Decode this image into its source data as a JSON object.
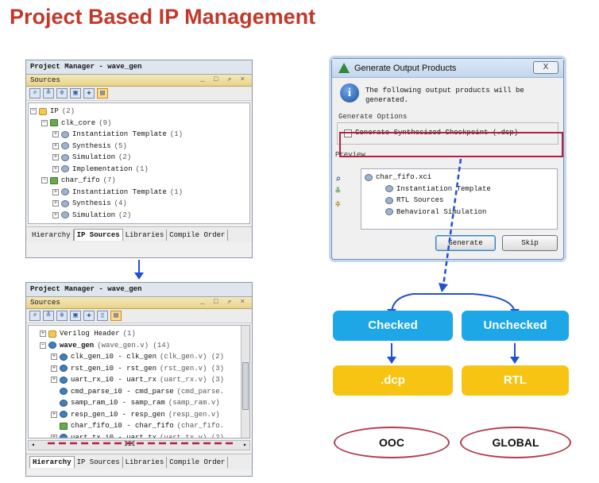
{
  "title": "Project Based IP Management",
  "top_panel": {
    "pm_title": "Project Manager - wave_gen",
    "sources_label": "Sources",
    "window_controls": "_ □ ⇗ ×",
    "tree": [
      {
        "exp": "−",
        "icon": "fold",
        "text": "IP",
        "extra": "(2)",
        "indent": 0,
        "bold": false
      },
      {
        "exp": "−",
        "icon": "ipico",
        "text": "clk_core",
        "extra": "(9)",
        "indent": 1,
        "bold": false
      },
      {
        "exp": "+",
        "icon": "gear",
        "text": "Instantiation Template",
        "extra": "(1)",
        "indent": 2,
        "bold": false
      },
      {
        "exp": "+",
        "icon": "gear",
        "text": "Synthesis",
        "extra": "(5)",
        "indent": 2,
        "bold": false
      },
      {
        "exp": "+",
        "icon": "gear",
        "text": "Simulation",
        "extra": "(2)",
        "indent": 2,
        "bold": false
      },
      {
        "exp": "+",
        "icon": "gear",
        "text": "Implementation",
        "extra": "(1)",
        "indent": 2,
        "bold": false
      },
      {
        "exp": "−",
        "icon": "ipico",
        "text": "char_fifo",
        "extra": "(7)",
        "indent": 1,
        "bold": false
      },
      {
        "exp": "+",
        "icon": "gear",
        "text": "Instantiation Template",
        "extra": "(1)",
        "indent": 2,
        "bold": false
      },
      {
        "exp": "+",
        "icon": "gear",
        "text": "Synthesis",
        "extra": "(4)",
        "indent": 2,
        "bold": false
      },
      {
        "exp": "+",
        "icon": "gear",
        "text": "Simulation",
        "extra": "(2)",
        "indent": 2,
        "bold": false
      }
    ],
    "tabs": [
      "Hierarchy",
      "IP Sources",
      "Libraries",
      "Compile Order"
    ],
    "active_tab": "IP Sources"
  },
  "bottom_panel": {
    "pm_title": "Project Manager - wave_gen",
    "sources_label": "Sources",
    "window_controls": "_ □ ⇗ ×",
    "tree": [
      {
        "exp": "+",
        "icon": "fold",
        "text": "Verilog Header",
        "extra": "(1)",
        "indent": 0,
        "bold": false
      },
      {
        "exp": "−",
        "icon": "vico",
        "text": "wave_gen",
        "extra": "(wave_gen.v) (14)",
        "indent": 0,
        "bold": true
      },
      {
        "exp": "+",
        "icon": "vico",
        "text": "clk_gen_i0 - clk_gen",
        "extra": "(clk_gen.v) (2)",
        "indent": 1,
        "bold": false
      },
      {
        "exp": "+",
        "icon": "vico",
        "text": "rst_gen_i0 - rst_gen",
        "extra": "(rst_gen.v) (3)",
        "indent": 1,
        "bold": false
      },
      {
        "exp": "+",
        "icon": "vico",
        "text": "uart_rx_i0 - uart_rx",
        "extra": "(uart_rx.v) (3)",
        "indent": 1,
        "bold": false
      },
      {
        "exp": "",
        "icon": "vico",
        "text": "cmd_parse_i0 - cmd_parse",
        "extra": "(cmd_parse.",
        "indent": 1,
        "bold": false
      },
      {
        "exp": "",
        "icon": "vico",
        "text": "samp_ram_i0 - samp_ram",
        "extra": "(samp_ram.v)",
        "indent": 1,
        "bold": false
      },
      {
        "exp": "+",
        "icon": "vico",
        "text": "resp_gen_i0 - resp_gen",
        "extra": "(resp_gen.v)",
        "indent": 1,
        "bold": false
      },
      {
        "exp": "",
        "icon": "ipico",
        "text": "char_fifo_i0 - char_fifo",
        "extra": "(char_fifo.",
        "indent": 1,
        "bold": false
      },
      {
        "exp": "+",
        "icon": "vico",
        "text": "uart_tx_i0 - uart_tx",
        "extra": "(uart_tx.v) (2)",
        "indent": 1,
        "bold": false
      }
    ],
    "hscroll_mark": "III",
    "tabs": [
      "Hierarchy",
      "IP Sources",
      "Libraries",
      "Compile Order"
    ],
    "active_tab": "Hierarchy"
  },
  "dialog": {
    "title": "Generate Output Products",
    "close": "X",
    "message": "The following output products will be generated.",
    "options_label": "Generate Options",
    "checkbox_label": "Generate Synthesized Checkpoint (.dcp)",
    "preview_label": "Preview",
    "preview_tree": [
      {
        "text": "char_fifo.xci",
        "indent": 0
      },
      {
        "text": "Instantiation Template",
        "indent": 1
      },
      {
        "text": "RTL Sources",
        "indent": 1
      },
      {
        "text": "Behavioral Simulation",
        "indent": 1
      }
    ],
    "generate_btn": "Generate",
    "skip_btn": "Skip"
  },
  "flow": {
    "checked": "Checked",
    "unchecked": "Unchecked",
    "dcp": ".dcp",
    "rtl": "RTL",
    "ooc": "OOC",
    "global": "GLOBAL"
  },
  "colors": {
    "title": "#c0392b",
    "blue": "#1ea7e6",
    "yellow": "#f8c413",
    "oval": "#b13c4b",
    "arrow": "#1f4fd6",
    "highlight": "#b51f45"
  }
}
